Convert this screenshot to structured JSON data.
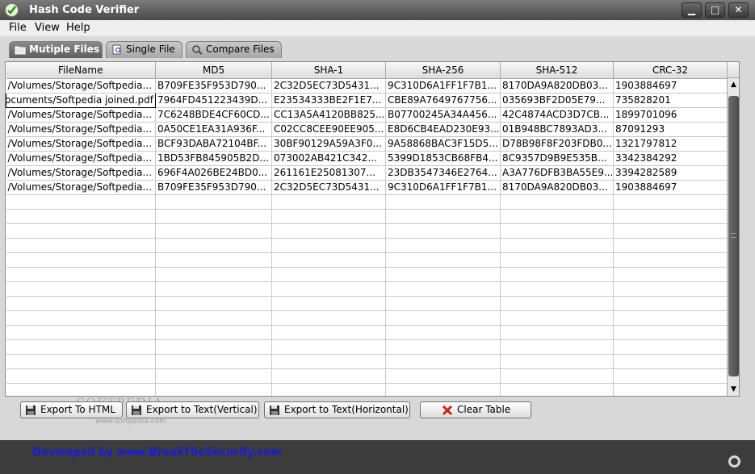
{
  "window": {
    "title": "Hash Code Verifier",
    "minimize": "▁",
    "maximize": "□",
    "close": "✕"
  },
  "menu": [
    "File",
    "View",
    "Help"
  ],
  "tabs": [
    {
      "label": "Mutiple Files",
      "icon": "folder-icon",
      "active": true
    },
    {
      "label": "Single File",
      "icon": "file-search-icon",
      "active": false
    },
    {
      "label": "Compare Files",
      "icon": "compare-icon",
      "active": false
    }
  ],
  "table": {
    "columns": [
      "FileName",
      "MD5",
      "SHA-1",
      "SHA-256",
      "SHA-512",
      "CRC-32"
    ],
    "rows": [
      [
        "/Volumes/Storage/Softpedia...",
        "B709FE35F953D790...",
        "2C32D5EC73D5431...",
        "9C310D6A1FF1F7B1...",
        "8170DA9A820DB03...",
        "1903884697"
      ],
      [
        "ocuments/Softpedia joined.pdf",
        "7964FD451223439D...",
        "E23534333BE2F1E7...",
        "CBE89A7649767756...",
        "035693BF2D05E79...",
        "735828201"
      ],
      [
        "/Volumes/Storage/Softpedia...",
        "7C6248BDE4CF60CD...",
        "CC13A5A4120BB825...",
        "B07700245A34A456...",
        "42C4874ACD3D7CB...",
        "1899701096"
      ],
      [
        "/Volumes/Storage/Softpedia...",
        "0A50CE1EA31A936F...",
        "C02CC8CEE90EE905...",
        "E8D6CB4EAD230E93...",
        "01B948BC7893AD3...",
        "87091293"
      ],
      [
        "/Volumes/Storage/Softpedia...",
        "BCF93DABA72104BF...",
        "30BF90129A59A3F0...",
        "9A58868BAC3F15D5...",
        "D78B98F8F203FDB0...",
        "1321797812"
      ],
      [
        "/Volumes/Storage/Softpedia...",
        "1BD53FB845905B2D...",
        "073002AB421C342...",
        "5399D1853CB68FB4...",
        "8C9357D9B9E535B...",
        "3342384292"
      ],
      [
        "/Volumes/Storage/Softpedia...",
        "696F4A026BE24BD0...",
        "261161E25081307...",
        "23DB3547346E2764...",
        "A3A776DFB3BA55E9...",
        "3394282589"
      ],
      [
        "/Volumes/Storage/Softpedia...",
        "B709FE35F953D790...",
        "2C32D5EC73D5431...",
        "9C310D6A1FF1F7B1...",
        "8170DA9A820DB03...",
        "1903884697"
      ]
    ],
    "empty_rows": 14
  },
  "buttons": {
    "export_html": "Export To HTML",
    "export_text_vertical": "Export to Text(Vertical)",
    "export_text_horizontal": "Export to Text(Horizontal)",
    "clear_table": "Clear Table"
  },
  "watermark": {
    "main": "SOFTPEDIA",
    "sub": "www.softpedia.com"
  },
  "footer": {
    "credit": "Developed by www.BreakTheSecurity.com"
  },
  "colors": {
    "titlebar": "#4a4a4a",
    "footer_link": "#1a1ae0",
    "clear_icon": "#d02020"
  }
}
